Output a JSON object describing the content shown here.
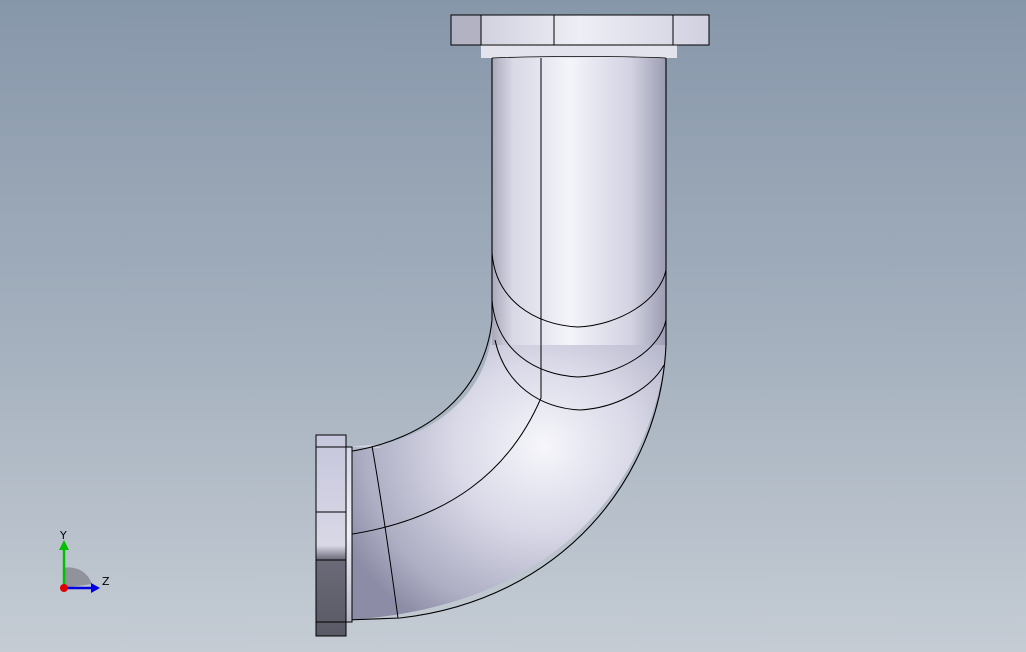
{
  "viewport": {
    "background_top": "#8797aa",
    "background_bottom": "#c5ccd4"
  },
  "model": {
    "part": "pipe-elbow-90-with-flanges",
    "surface_color": "#c9c9de",
    "edge_color": "#000000"
  },
  "triad": {
    "y_label": "Y",
    "z_label": "Z",
    "y_color": "#00c000",
    "z_color": "#0000e0",
    "x_color": "#e00000"
  }
}
